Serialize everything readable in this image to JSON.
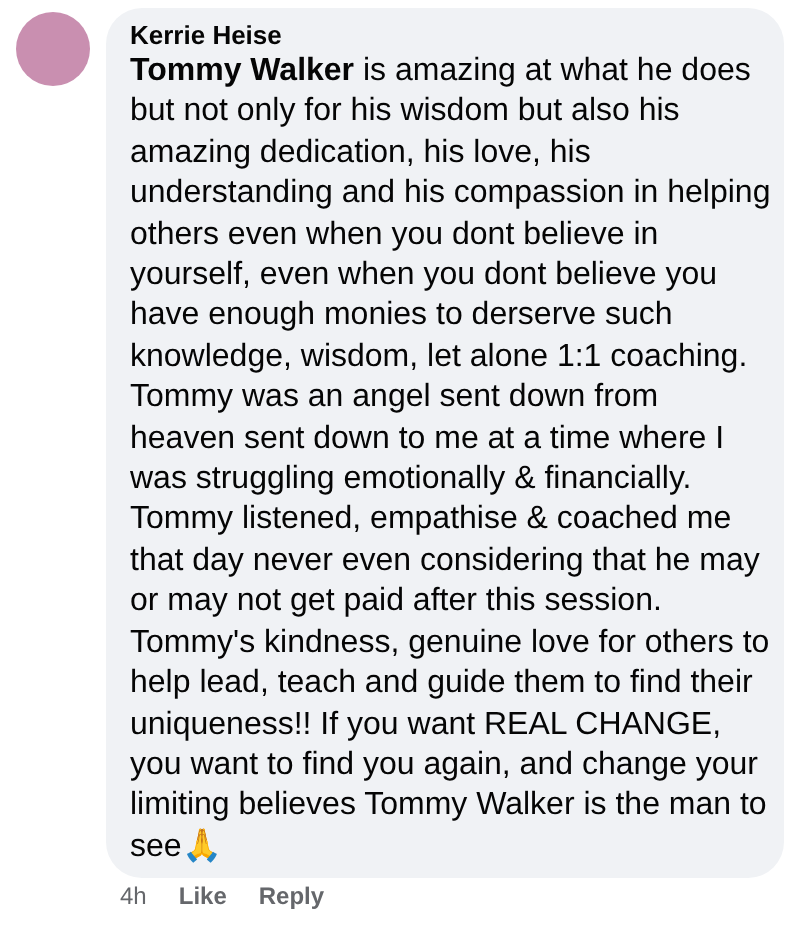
{
  "comment": {
    "author": "Kerrie Heise",
    "text": "**Tommy Walker** is amazing at what he does but not only for his wisdom but also his amazing dedication, his love, his understanding and his compassion in helping others even when you dont believe in yourself, even when you dont believe you have enough monies to derserve such knowledge, wisdom, let alone 1:1 coaching. Tommy was an angel sent down from heaven sent down to me at a time where I was struggling emotionally & financially. Tommy listened, empathise & coached me that day never even considering that he may or may not get paid after this session. Tommy's kindness, genuine love for others to help lead, teach and guide them to find their uniqueness!! If you want REAL CHANGE, you want to find you again, and change your limiting believes Tommy Walker is the man to see🙏",
    "actions": [
      "4h",
      "Like",
      "Reply"
    ]
  }
}
